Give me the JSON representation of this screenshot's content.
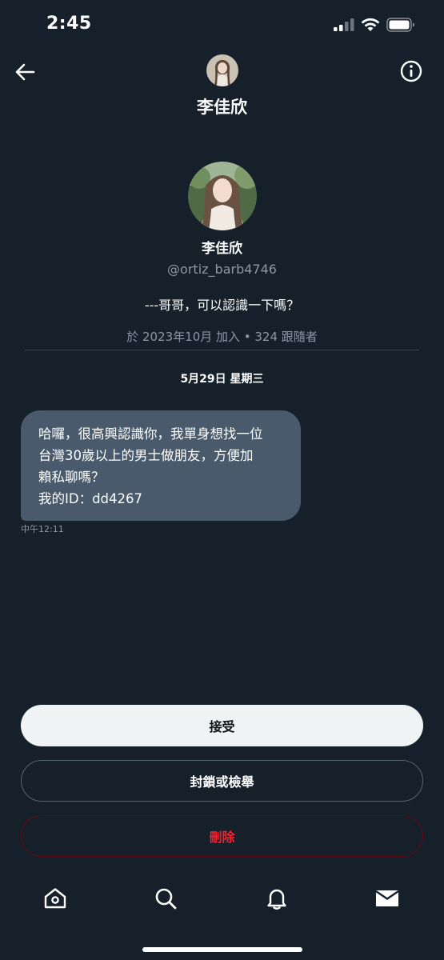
{
  "status_bar": {
    "time": "2:45"
  },
  "header": {
    "name": "李佳欣"
  },
  "profile": {
    "name": "李佳欣",
    "handle": "@ortiz_barb4746",
    "bio": "---哥哥，可以認識一下嗎？",
    "meta": "於 2023年10月 加入 • 324 跟隨者"
  },
  "conversation": {
    "date_label": "5月29日 星期三",
    "message": {
      "lines": [
        "哈囉，很高興認識你，我單身想找一位",
        "台灣30歲以上的男士做朋友，方便加",
        "賴私聊嗎？",
        "我的ID：dd4267"
      ],
      "time": "中午12:11"
    }
  },
  "actions": {
    "accept_label": "接受",
    "block_label": "封鎖或檢舉",
    "delete_label": "刪除"
  },
  "tabs": [
    "home-icon",
    "search-icon",
    "bell-icon",
    "mail-icon"
  ],
  "colors": {
    "background": "#15202b",
    "bubble": "#485a6b",
    "muted_text": "#8b98a5",
    "danger": "#f4212e"
  }
}
